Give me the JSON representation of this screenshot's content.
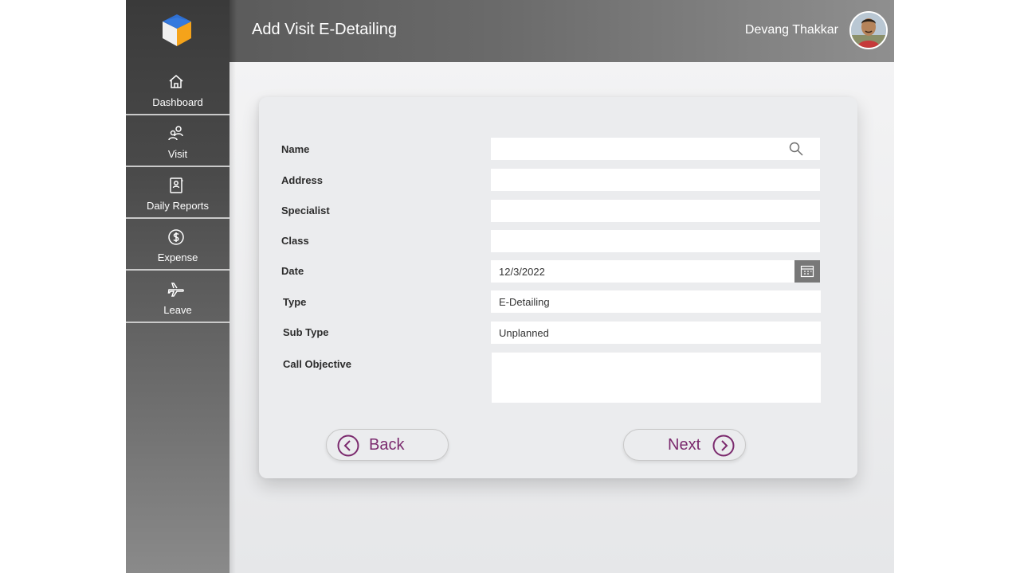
{
  "header": {
    "title": "Add Visit E-Detailing",
    "user_name": "Devang Thakkar"
  },
  "sidebar": {
    "items": [
      {
        "label": "Dashboard",
        "icon": "home-icon"
      },
      {
        "label": "Visit",
        "icon": "users-icon"
      },
      {
        "label": "Daily Reports",
        "icon": "report-book-icon"
      },
      {
        "label": "Expense",
        "icon": "dollar-icon"
      },
      {
        "label": "Leave",
        "icon": "airplane-icon"
      }
    ]
  },
  "form": {
    "name": {
      "label": "Name",
      "value": ""
    },
    "address": {
      "label": "Address",
      "value": ""
    },
    "specialist": {
      "label": "Specialist",
      "value": ""
    },
    "class": {
      "label": "Class",
      "value": ""
    },
    "date": {
      "label": "Date",
      "value": "12/3/2022"
    },
    "type": {
      "label": "Type",
      "value": "E-Detailing"
    },
    "sub_type": {
      "label": "Sub Type",
      "value": "Unplanned"
    },
    "call_objective": {
      "label": "Call Objective",
      "value": ""
    }
  },
  "buttons": {
    "back": "Back",
    "next": "Next"
  },
  "colors": {
    "accent": "#7b2a6e",
    "sidebar_top": "#3a3a3a",
    "header": "#6a6a6a"
  }
}
